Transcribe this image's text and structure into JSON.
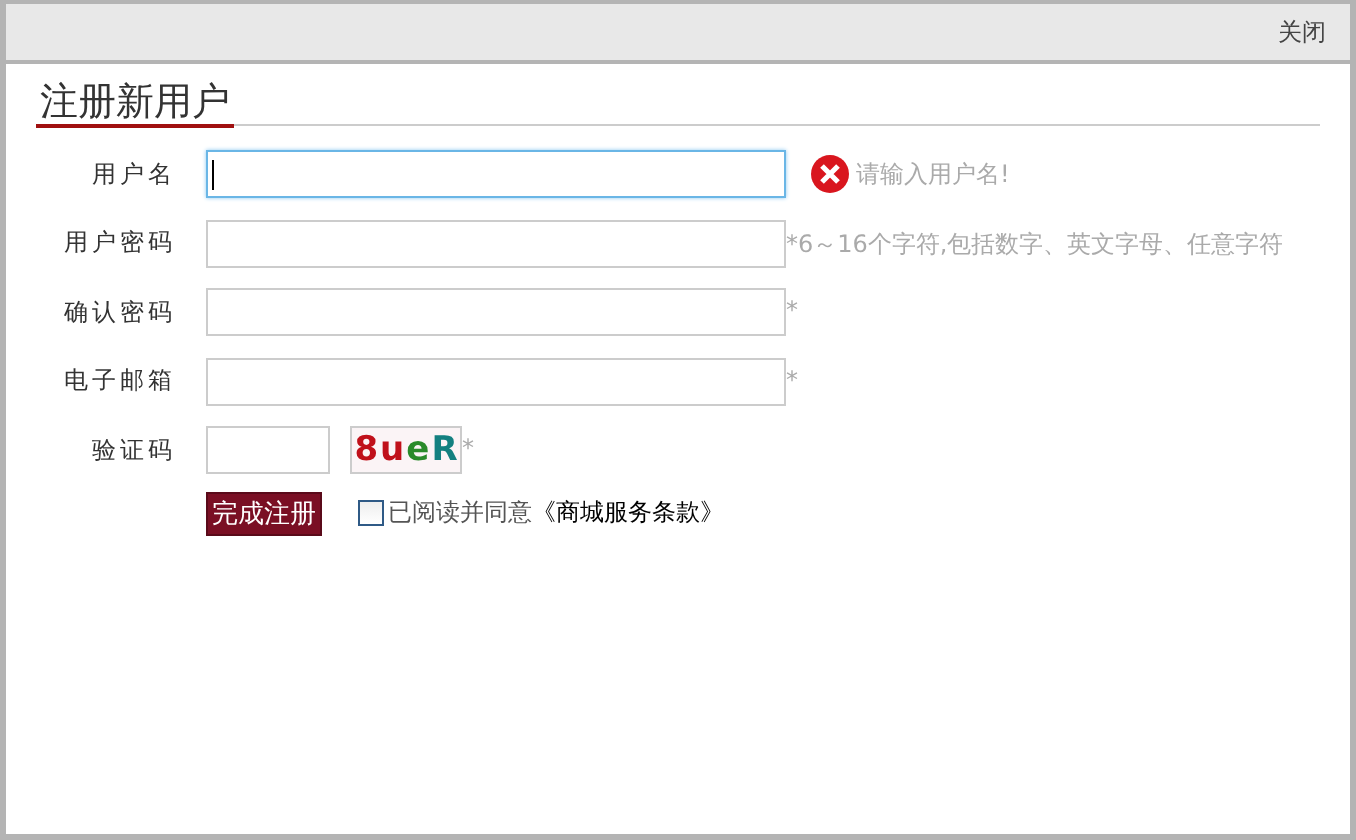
{
  "window": {
    "close": "关闭"
  },
  "title": "注册新用户",
  "fields": [
    {
      "label": "用户名",
      "focused": true,
      "error": "请输入用户名!"
    },
    {
      "label": "用户密码",
      "focused": false,
      "hint": "*6～16个字符,包括数字、英文字母、任意字符"
    },
    {
      "label": "确认密码",
      "focused": false,
      "hint": "*"
    },
    {
      "label": "电子邮箱",
      "focused": false,
      "hint": "*"
    }
  ],
  "captcha": {
    "label": "验证码",
    "code": "8ueR",
    "hint": "*"
  },
  "submit": "完成注册",
  "agree": {
    "checked": false,
    "text": "已阅读并同意",
    "link": "《商城服务条款》"
  }
}
